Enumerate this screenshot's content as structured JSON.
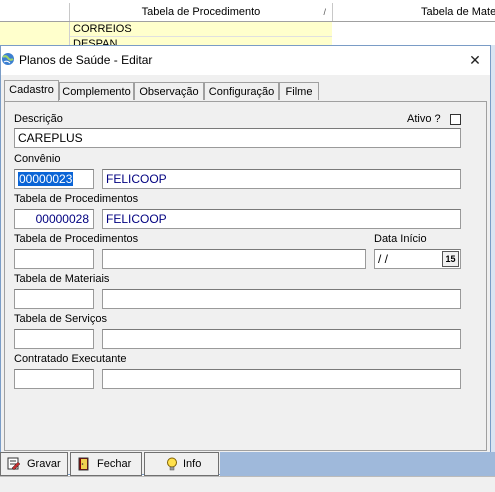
{
  "grid": {
    "columns": [
      {
        "label": "Tabela de Procedimento",
        "sort": "/"
      },
      {
        "label": "Tabela de Mate"
      }
    ],
    "rows": [
      "CORREIOS",
      "DESPAN"
    ]
  },
  "dialog": {
    "title": "Planos de Saúde - Editar",
    "close_glyph": "✕",
    "tabs": [
      "Cadastro",
      "Complemento",
      "Observação",
      "Configuração",
      "Filme"
    ],
    "active_tab": "Cadastro",
    "fields": {
      "descricao": {
        "label": "Descrição",
        "value": "CAREPLUS"
      },
      "ativo": {
        "label": "Ativo ?",
        "checked": false
      },
      "convenio": {
        "label": "Convênio",
        "code": "00000023",
        "name": "FELICOOP"
      },
      "tabela_proc_1": {
        "label": "Tabela de Procedimentos",
        "code": "00000028",
        "name": "FELICOOP"
      },
      "tabela_proc_2": {
        "label": "Tabela de Procedimentos",
        "code": "",
        "name": ""
      },
      "data_inicio": {
        "label": "Data Início",
        "value": "/ /",
        "button": "15"
      },
      "tabela_materiais": {
        "label": "Tabela de Materiais",
        "code": "",
        "name": ""
      },
      "tabela_servicos": {
        "label": "Tabela de Serviços",
        "code": "",
        "name": ""
      },
      "contratado": {
        "label": "Contratado Executante",
        "code": "",
        "name": ""
      }
    }
  },
  "buttons": {
    "gravar": "Gravar",
    "fechar": "Fechar",
    "info": "Info"
  }
}
